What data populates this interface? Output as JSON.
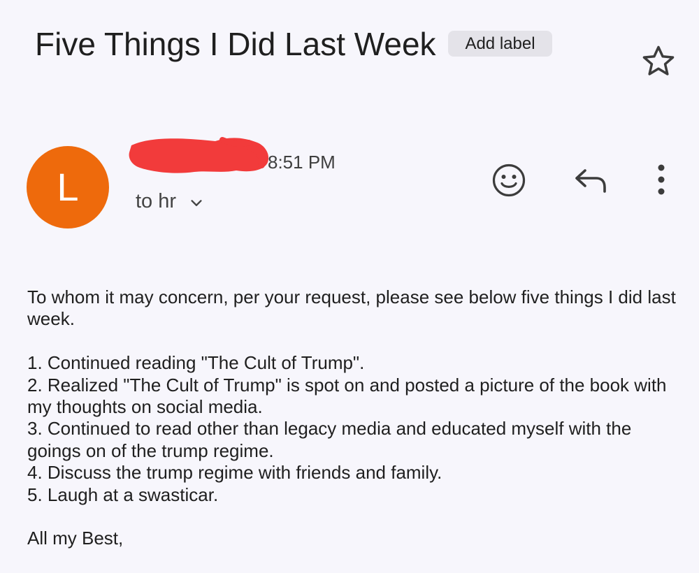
{
  "email": {
    "subject": "Five Things I Did Last Week",
    "label_button": "Add label",
    "sender_avatar_initial": "L",
    "sender_avatar_color": "#ee6a0c",
    "time": "8:51 PM",
    "recipient": "to hr",
    "body": {
      "intro": "To whom it may concern, per your request, please see below five things I did last week.",
      "items": [
        "1. Continued reading \"The Cult of Trump\".",
        "2. Realized \"The Cult of Trump\" is spot on and posted a picture of the book with my thoughts on social media.",
        "3. Continued to read other than legacy media and educated myself with the goings on of the trump regime.",
        "4. Discuss the trump regime with friends and family.",
        "5. Laugh at a swasticar."
      ],
      "signoff": "All my Best,"
    }
  },
  "icons": {
    "star": "star-outline-icon",
    "chevron": "chevron-down-icon",
    "emoji": "add-reaction-icon",
    "reply": "reply-icon",
    "more": "more-vert-icon"
  },
  "colors": {
    "background": "#f7f6fc",
    "chip": "#e4e3e9",
    "redaction": "#f23b3b"
  }
}
